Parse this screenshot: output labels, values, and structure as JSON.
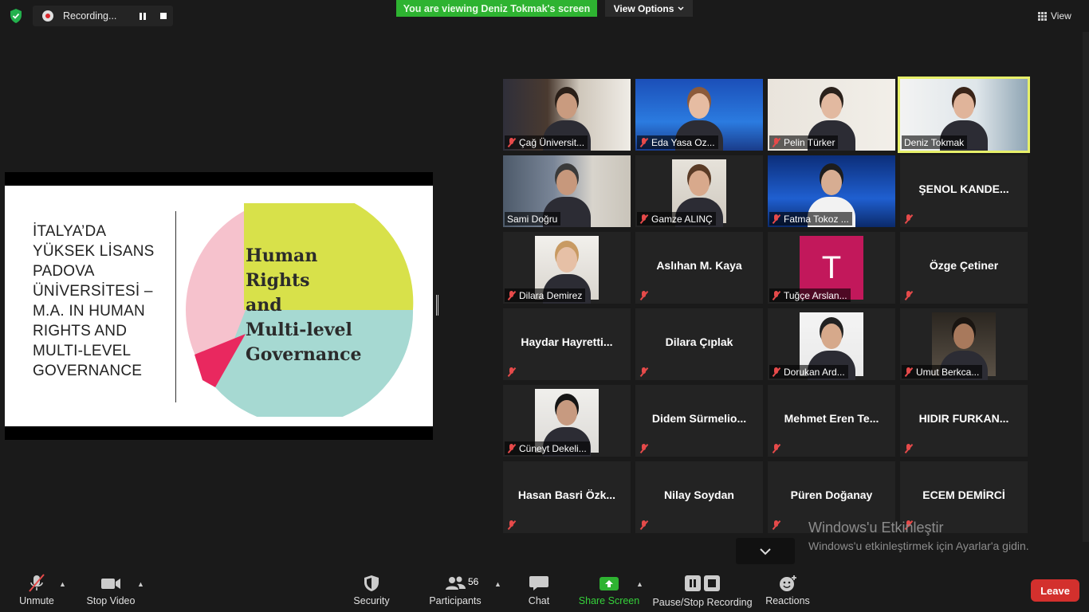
{
  "recording": {
    "label": "Recording..."
  },
  "banner": {
    "viewing": "You are viewing Deniz Tokmak's screen",
    "view_options": "View Options"
  },
  "view": {
    "label": "View"
  },
  "slide": {
    "title": "İTALYA’DA\nYÜKSEK LİSANS\nPADOVA\nÜNİVERSİTESİ –\nM.A. IN HUMAN\nRIGHTS AND\nMULTI-LEVEL\nGOVERNANCE",
    "pie_text": "Human\nRights\nand\nMulti-level\nGovernance"
  },
  "participants": [
    {
      "name": "Çağ Üniversit...",
      "video": true,
      "muted": true
    },
    {
      "name": "Eda Yasa Oz...",
      "video": true,
      "muted": true
    },
    {
      "name": "Pelin Türker",
      "video": true,
      "muted": true
    },
    {
      "name": "Deniz Tokmak",
      "video": true,
      "muted": false,
      "active": true
    },
    {
      "name": "Sami Doğru",
      "video": true,
      "muted": false
    },
    {
      "name": "Gamze ALINÇ",
      "video": true,
      "muted": true
    },
    {
      "name": "Fatma Tokoz ...",
      "video": true,
      "muted": true
    },
    {
      "name": "ŞENOL KANDE...",
      "video": false,
      "muted": true
    },
    {
      "name": "Dilara Demirez",
      "video": true,
      "muted": true
    },
    {
      "name": "Aslıhan M. Kaya",
      "video": false,
      "muted": true
    },
    {
      "name": "Tuğçe Arslan...",
      "video": false,
      "avatar": "T",
      "muted": true
    },
    {
      "name": "Özge Çetiner",
      "video": false,
      "muted": true
    },
    {
      "name": "Haydar Hayretti...",
      "video": false,
      "muted": true
    },
    {
      "name": "Dilara Çıplak",
      "video": false,
      "muted": true
    },
    {
      "name": "Dorukan Ard...",
      "video": true,
      "muted": true
    },
    {
      "name": "Umut Berkca...",
      "video": true,
      "muted": true
    },
    {
      "name": "Cüneyt Dekeli...",
      "video": true,
      "muted": true
    },
    {
      "name": "Didem Sürmelio...",
      "video": false,
      "muted": true
    },
    {
      "name": "Mehmet Eren Te...",
      "video": false,
      "muted": true
    },
    {
      "name": "HIDIR FURKAN...",
      "video": false,
      "muted": true
    },
    {
      "name": "Hasan Basri Özk...",
      "video": false,
      "muted": true
    },
    {
      "name": "Nilay Soydan",
      "video": false,
      "muted": true
    },
    {
      "name": "Püren Doğanay",
      "video": false,
      "muted": true
    },
    {
      "name": "ECEM DEMİRCİ",
      "video": false,
      "muted": true
    }
  ],
  "toolbar": {
    "unmute": "Unmute",
    "stop_video": "Stop Video",
    "security": "Security",
    "participants": "Participants",
    "participants_count": "56",
    "chat": "Chat",
    "share_screen": "Share Screen",
    "pause_stop_recording": "Pause/Stop Recording",
    "reactions": "Reactions",
    "leave": "Leave"
  },
  "watermark": {
    "title": "Windows'u Etkinleştir",
    "subtitle": "Windows'u etkinleştirmek için Ayarlar'a gidin."
  },
  "colors": {
    "accent_green": "#2eb331",
    "leave_red": "#d3302d",
    "active_border": "#e7f06a"
  }
}
